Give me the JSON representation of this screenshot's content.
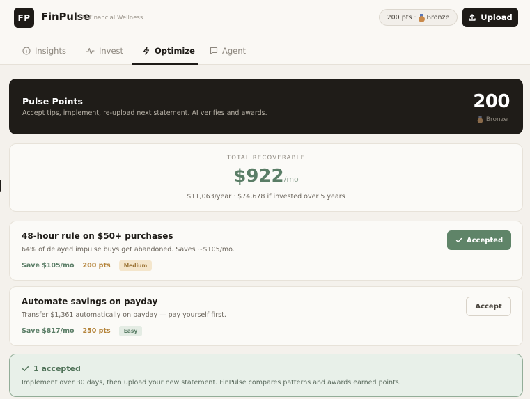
{
  "app": {
    "logo_text": "FP",
    "name": "FinPulse",
    "tagline": "AI Financial Wellness"
  },
  "header": {
    "points_pill": "200 pts ·",
    "tier": "Bronze",
    "upload_label": "Upload"
  },
  "tabs": [
    {
      "label": "Insights",
      "icon": "info-icon"
    },
    {
      "label": "Invest",
      "icon": "activity-icon"
    },
    {
      "label": "Optimize",
      "icon": "lightning-icon",
      "active": true
    },
    {
      "label": "Agent",
      "icon": "chat-icon"
    }
  ],
  "pulse": {
    "title": "Pulse Points",
    "subtitle": "Accept tips, implement, re-upload next statement. AI verifies and awards.",
    "value": "200",
    "tier": "Bronze"
  },
  "total": {
    "label": "TOTAL RECOVERABLE",
    "amount": "$922",
    "unit": "/mo",
    "detail": "$11,063/year · $74,678 if invested over 5 years"
  },
  "tips": [
    {
      "title": "48-hour rule on $50+ purchases",
      "description": "64% of delayed impulse buys get abandoned. Saves ~$105/mo.",
      "save": "Save $105/mo",
      "points": "200 pts",
      "difficulty": "Medium",
      "status_label": "Accepted",
      "accepted": true
    },
    {
      "title": "Automate savings on payday",
      "description": "Transfer $1,361 automatically on payday — pay yourself first.",
      "save": "Save $817/mo",
      "points": "250 pts",
      "difficulty": "Easy",
      "status_label": "Accept",
      "accepted": false
    }
  ],
  "banner": {
    "title": "1 accepted",
    "text": "Implement over 30 days, then upload your new statement. FinPulse compares patterns and awards earned points."
  },
  "colors": {
    "accent_green": "#5f8468",
    "dark": "#1e1b17",
    "points_gold": "#b4833a",
    "background": "#f4f1ec"
  }
}
